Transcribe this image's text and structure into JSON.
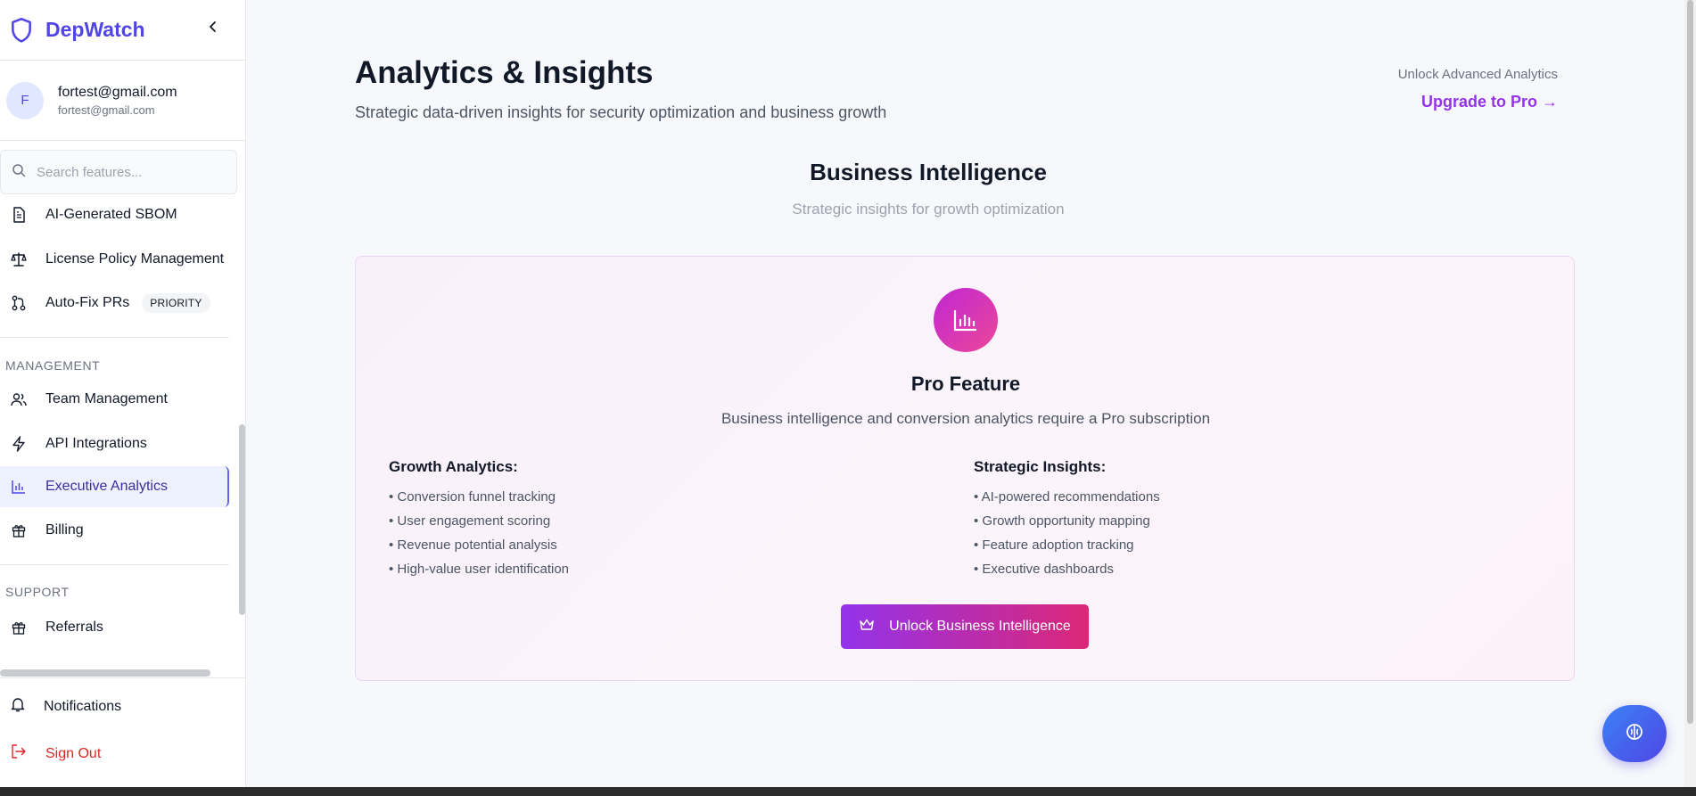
{
  "sidebar": {
    "brand": "DepWatch",
    "user": {
      "initial": "F",
      "name": "fortest@gmail.com",
      "email": "fortest@gmail.com"
    },
    "search_placeholder": "Search features...",
    "items_top": [
      {
        "label": "AI-Generated SBOM",
        "icon": "document-icon"
      },
      {
        "label": "License Policy Management",
        "icon": "scale-icon"
      },
      {
        "label": "Auto-Fix PRs",
        "icon": "git-pull-request-icon",
        "badge": "PRIORITY"
      }
    ],
    "sections": {
      "management": "MANAGEMENT",
      "support": "SUPPORT"
    },
    "items_management": [
      {
        "label": "Team Management",
        "icon": "users-icon"
      },
      {
        "label": "API Integrations",
        "icon": "lightning-icon"
      },
      {
        "label": "Executive Analytics",
        "icon": "bar-chart-icon",
        "active": true
      },
      {
        "label": "Billing",
        "icon": "gift-icon"
      }
    ],
    "items_support": [
      {
        "label": "Referrals",
        "icon": "gift-icon"
      }
    ],
    "bottom": {
      "notifications": "Notifications",
      "sign_out": "Sign Out"
    }
  },
  "header": {
    "title": "Analytics & Insights",
    "subtitle": "Strategic data-driven insights for security optimization and business growth",
    "upgrade_caption": "Unlock Advanced Analytics",
    "upgrade_link": "Upgrade to Pro →"
  },
  "section": {
    "title": "Business Intelligence",
    "subtitle": "Strategic insights for growth optimization"
  },
  "pro_card": {
    "icon": "bar-chart-icon",
    "title": "Pro Feature",
    "description": "Business intelligence and conversion analytics require a Pro subscription",
    "left": {
      "title": "Growth Analytics:",
      "items": [
        "• Conversion funnel tracking",
        "• User engagement scoring",
        "• Revenue potential analysis",
        "• High-value user identification"
      ]
    },
    "right": {
      "title": "Strategic Insights:",
      "items": [
        "• AI-powered recommendations",
        "• Growth opportunity mapping",
        "• Feature adoption tracking",
        "• Executive dashboards"
      ]
    },
    "button": "Unlock Business Intelligence"
  },
  "colors": {
    "brand": "#4f46e5",
    "pro_gradient_start": "#9333ea",
    "pro_gradient_end": "#db2777",
    "danger": "#dc2626"
  }
}
